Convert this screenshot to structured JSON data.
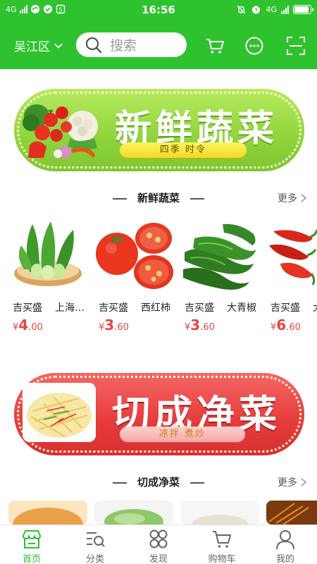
{
  "status_bar": {
    "network_left": "4G",
    "time": "16:56",
    "network_right": "4G"
  },
  "header": {
    "location": "吴江区",
    "search_placeholder": "搜索"
  },
  "banners": [
    {
      "title": "新鲜蔬菜",
      "subtitle": "四季 时令"
    },
    {
      "title": "切成净菜",
      "subtitle": "凉拌 煮炒"
    }
  ],
  "sections": [
    {
      "title": "新鲜蔬菜",
      "more": "更多",
      "products": [
        {
          "shop": "吉买盛",
          "name": "上海…",
          "price_symbol": "¥",
          "price_int": "4",
          "price_dec": ".00"
        },
        {
          "shop": "吉买盛",
          "name": "西红柿",
          "price_symbol": "¥",
          "price_int": "3",
          "price_dec": ".60"
        },
        {
          "shop": "吉买盛",
          "name": "大青椒",
          "price_symbol": "¥",
          "price_int": "3",
          "price_dec": ".60"
        },
        {
          "shop": "吉买盛",
          "name": "大",
          "price_symbol": "¥",
          "price_int": "6",
          "price_dec": ".60"
        }
      ]
    },
    {
      "title": "切成净菜",
      "more": "更多"
    }
  ],
  "tabbar": {
    "items": [
      {
        "label": "首页",
        "icon": "home-store-icon",
        "active": true
      },
      {
        "label": "分类",
        "icon": "category-search-icon",
        "active": false
      },
      {
        "label": "发现",
        "icon": "discover-grid-icon",
        "active": false
      },
      {
        "label": "购物车",
        "icon": "cart-icon",
        "active": false
      },
      {
        "label": "我的",
        "icon": "profile-icon",
        "active": false
      }
    ]
  },
  "colors": {
    "brand_green": "#2fc22f",
    "price_red": "#e64545",
    "banner_green": "#8fd43c",
    "banner_red": "#e63b3b"
  }
}
